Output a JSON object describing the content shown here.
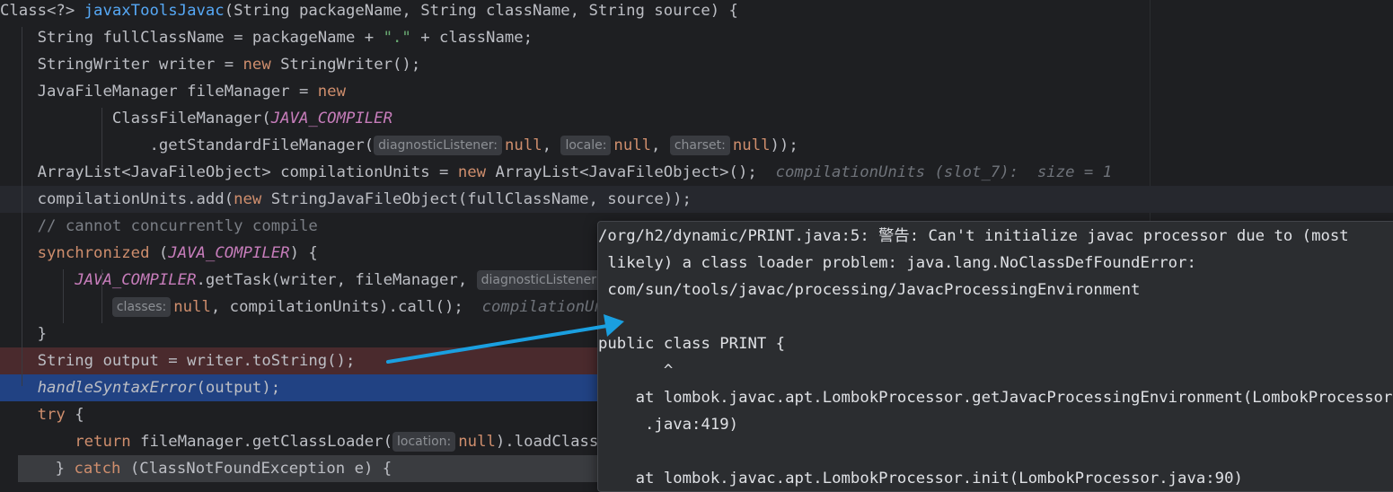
{
  "editor": {
    "lines": [
      {
        "indent": "",
        "parts": [
          [
            "plain",
            "Class<?> "
          ],
          [
            "fn",
            "javaxToolsJavac"
          ],
          [
            "plain",
            "(String packageName, String className, String source) {"
          ]
        ]
      },
      {
        "indent": "    ",
        "parts": [
          [
            "plain",
            "String fullClassName = packageName + "
          ],
          [
            "st",
            "\".\""
          ],
          [
            "plain",
            " + className;"
          ]
        ]
      },
      {
        "indent": "    ",
        "parts": [
          [
            "plain",
            "StringWriter writer = "
          ],
          [
            "kw",
            "new"
          ],
          [
            "plain",
            " StringWriter();"
          ]
        ]
      },
      {
        "indent": "    ",
        "parts": [
          [
            "plain",
            "JavaFileManager fileManager = "
          ],
          [
            "kw",
            "new"
          ]
        ]
      },
      {
        "indent": "            ",
        "parts": [
          [
            "plain",
            "ClassFileManager("
          ],
          [
            "sf",
            "JAVA_COMPILER"
          ]
        ]
      },
      {
        "indent": "                ",
        "parts": [
          [
            "plain",
            ".getStandardFileManager("
          ],
          [
            "hint",
            "diagnosticListener:"
          ],
          [
            "kw",
            "null"
          ],
          [
            "plain",
            ", "
          ],
          [
            "hint",
            "locale:"
          ],
          [
            "kw",
            "null"
          ],
          [
            "plain",
            ", "
          ],
          [
            "hint",
            "charset:"
          ],
          [
            "kw",
            "null"
          ],
          [
            "plain",
            "));"
          ]
        ]
      },
      {
        "indent": "    ",
        "parts": [
          [
            "plain",
            "ArrayList<JavaFileObject> compilationUnits = "
          ],
          [
            "kw",
            "new"
          ],
          [
            "plain",
            " ArrayList<JavaFileObject>();  "
          ],
          [
            "inl",
            "compilationUnits (slot_7):  size = 1"
          ]
        ]
      },
      {
        "indent": "    ",
        "parts": [
          [
            "plain",
            "compilationUnits.add("
          ],
          [
            "kw",
            "new"
          ],
          [
            "plain",
            " StringJavaFileObject(fullClassName, source));"
          ]
        ]
      },
      {
        "indent": "    ",
        "parts": [
          [
            "cm",
            "// cannot concurrently compile"
          ]
        ]
      },
      {
        "indent": "    ",
        "parts": [
          [
            "kw",
            "synchronized"
          ],
          [
            "plain",
            " ("
          ],
          [
            "sf",
            "JAVA_COMPILER"
          ],
          [
            "plain",
            ") {"
          ]
        ]
      },
      {
        "indent": "        ",
        "parts": [
          [
            "sf",
            "JAVA_COMPILER"
          ],
          [
            "plain",
            ".getTask(writer, fileManager, "
          ],
          [
            "hint",
            "diagnosticListener:"
          ]
        ]
      },
      {
        "indent": "            ",
        "parts": [
          [
            "hint",
            "classes:"
          ],
          [
            "kw",
            "null"
          ],
          [
            "plain",
            ", compilationUnits).call();  "
          ],
          [
            "inl",
            "compilationUnits"
          ]
        ]
      },
      {
        "indent": "    ",
        "parts": [
          [
            "plain",
            "}"
          ]
        ]
      },
      {
        "indent": "    ",
        "parts": [
          [
            "plain",
            "String output = writer.toString();"
          ]
        ]
      },
      {
        "indent": "    ",
        "parts": [
          [
            "it",
            "handleSyntaxError"
          ],
          [
            "plain",
            "(output);"
          ]
        ]
      },
      {
        "indent": "    ",
        "parts": [
          [
            "kw",
            "try"
          ],
          [
            "plain",
            " {"
          ]
        ]
      },
      {
        "indent": "        ",
        "parts": [
          [
            "kw",
            "return"
          ],
          [
            "plain",
            " fileManager.getClassLoader("
          ],
          [
            "hint",
            "location:"
          ],
          [
            "kw",
            "null"
          ],
          [
            "plain",
            ").loadClass(fullClassName);"
          ]
        ]
      },
      {
        "indent": "    ",
        "parts": [
          [
            "plain",
            "} "
          ],
          [
            "kw",
            "catch"
          ],
          [
            "plain",
            " (ClassNotFoundException e) {"
          ]
        ]
      }
    ]
  },
  "popup": {
    "lines": [
      "/org/h2/dynamic/PRINT.java:5: 警告: Can't initialize javac processor due to (most",
      " likely) a class loader problem: java.lang.NoClassDefFoundError:",
      " com/sun/tools/javac/processing/JavacProcessingEnvironment",
      "",
      "public class PRINT {",
      "       ^",
      "    at lombok.javac.apt.LombokProcessor.getJavacProcessingEnvironment(LombokProcessor",
      "     .java:419)",
      "",
      "    at lombok.javac.apt.LombokProcessor.init(LombokProcessor.java:90)"
    ]
  },
  "colors": {
    "accent_arrow": "#1a9fe0",
    "selection": "#214283",
    "error_line": "#4a2a2d"
  }
}
